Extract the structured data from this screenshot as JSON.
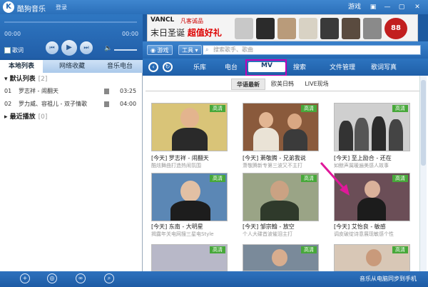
{
  "app": {
    "logo_letter": "K",
    "title": "酷狗音乐",
    "login": "登录",
    "game": "游戏",
    "window_buttons": [
      "▣",
      "—",
      "▢",
      "✕"
    ]
  },
  "player": {
    "time_current": "00:00",
    "time_total": "00:00",
    "lyrics_label": "歌词",
    "controls": [
      "⏮",
      "▶",
      "⏭"
    ],
    "volume_icon": "🔈"
  },
  "left_tabs": [
    "本地列表",
    "网络收藏",
    "音乐电台"
  ],
  "playlist": {
    "default_group": "默认列表",
    "default_count": "[2]",
    "recent_group": "最近播放",
    "recent_count": "[0]",
    "songs": [
      {
        "num": "01",
        "name": "罗志祥 - 闹翻天",
        "duration": "03:25"
      },
      {
        "num": "02",
        "name": "罗力威、容祖儿 - 双子情歌",
        "duration": "04:00"
      }
    ]
  },
  "ad": {
    "brand": "VANCL",
    "brand_cn": "凡客诚品",
    "slogan_a": "末日圣诞",
    "slogan_b": "超值好礼",
    "badge": "88"
  },
  "toolbar": {
    "game_btn": "游戏",
    "tools_btn": "工具",
    "search_placeholder": "搜索歌手、歌曲"
  },
  "nav": {
    "items": [
      "乐库",
      "电台",
      "MV",
      "搜索",
      "文件管理",
      "歌词写真"
    ]
  },
  "mv": {
    "subtabs": [
      "华语最新",
      "欧美日韩",
      "LIVE现场"
    ],
    "hd_label": "高清",
    "cards": [
      {
        "title": "[今天] 罗志祥 - 闹翻天",
        "desc": "酷炫舞曲打造热闹氛围"
      },
      {
        "title": "[今天] 萧敬腾 - 兄弟我说",
        "desc": "萧敬腾新专第三波又不主打"
      },
      {
        "title": "[今天] 至上励合 - 还在",
        "desc": "如鲸声属暖遍美感人故事"
      },
      {
        "title": "[今天] 东南 - 大明星",
        "desc": "揭露年关电网搜三星电Style"
      },
      {
        "title": "[今天] 邹宗翰 - 放空",
        "desc": "个人大碟首波催泪主打"
      },
      {
        "title": "[今天] 艾怡良 - 敏感",
        "desc": "调皮破绽诗意展现敏感个性"
      },
      {
        "title": "",
        "desc": ""
      },
      {
        "title": "",
        "desc": ""
      },
      {
        "title": "",
        "desc": ""
      }
    ]
  },
  "bottom": {
    "icons": [
      "+",
      "◎",
      "∞",
      "⌕"
    ],
    "sync_text": "音乐从电脑同步到手机"
  },
  "colors": {
    "accent_blue": "#2b6fb9",
    "hd_green": "#47a83a",
    "highlight_magenta": "#c000b5"
  }
}
